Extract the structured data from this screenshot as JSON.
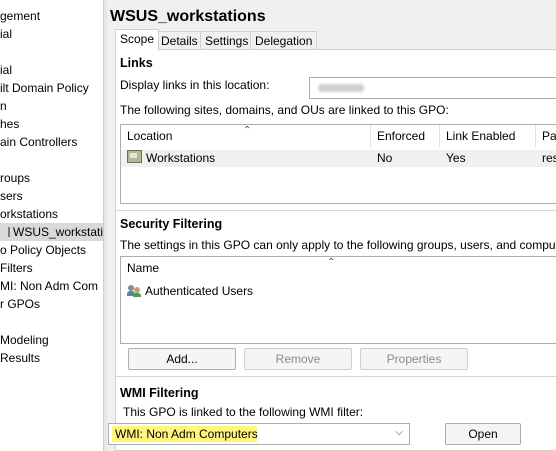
{
  "tree": {
    "items": [
      {
        "label": "gement",
        "selected": false
      },
      {
        "label": "ial",
        "selected": false
      },
      {
        "label": "",
        "selected": false
      },
      {
        "label": "ial",
        "selected": false
      },
      {
        "label": "ilt Domain Policy",
        "selected": false
      },
      {
        "label": "n",
        "selected": false
      },
      {
        "label": "hes",
        "selected": false
      },
      {
        "label": "ain Controllers",
        "selected": false
      },
      {
        "label": "",
        "selected": false
      },
      {
        "label": "roups",
        "selected": false
      },
      {
        "label": "sers",
        "selected": false
      },
      {
        "label": "orkstations",
        "selected": false
      },
      {
        "label": "WSUS_workstatio",
        "selected": true
      },
      {
        "label": "o Policy Objects",
        "selected": false
      },
      {
        "label": "Filters",
        "selected": false
      },
      {
        "label": "MI: Non Adm Com",
        "selected": false
      },
      {
        "label": "r GPOs",
        "selected": false
      },
      {
        "label": "",
        "selected": false
      },
      {
        "label": " Modeling",
        "selected": false
      },
      {
        "label": " Results",
        "selected": false
      }
    ]
  },
  "gpo": {
    "title": "WSUS_workstations",
    "tabs": [
      "Scope",
      "Details",
      "Settings",
      "Delegation"
    ],
    "active_tab": "Scope"
  },
  "links": {
    "heading": "Links",
    "display_label": "Display links in this location:",
    "list_caption": "The following sites, domains, and OUs are linked to this GPO:",
    "columns": [
      "Location",
      "Enforced",
      "Link Enabled",
      "Pat"
    ],
    "rows": [
      {
        "location": "Workstations",
        "enforced": "No",
        "link_enabled": "Yes",
        "path": "res"
      }
    ]
  },
  "security_filtering": {
    "heading": "Security Filtering",
    "caption": "The settings in this GPO can only apply to the following groups, users, and computers:",
    "column": "Name",
    "rows": [
      "Authenticated Users"
    ],
    "buttons": {
      "add": "Add...",
      "remove": "Remove",
      "properties": "Properties"
    }
  },
  "wmi_filtering": {
    "heading": "WMI Filtering",
    "caption": "This GPO is linked to the following WMI filter:",
    "selected_filter": "WMI: Non Adm Computers",
    "open_button": "Open",
    "highlight_color": "#fff67a"
  }
}
